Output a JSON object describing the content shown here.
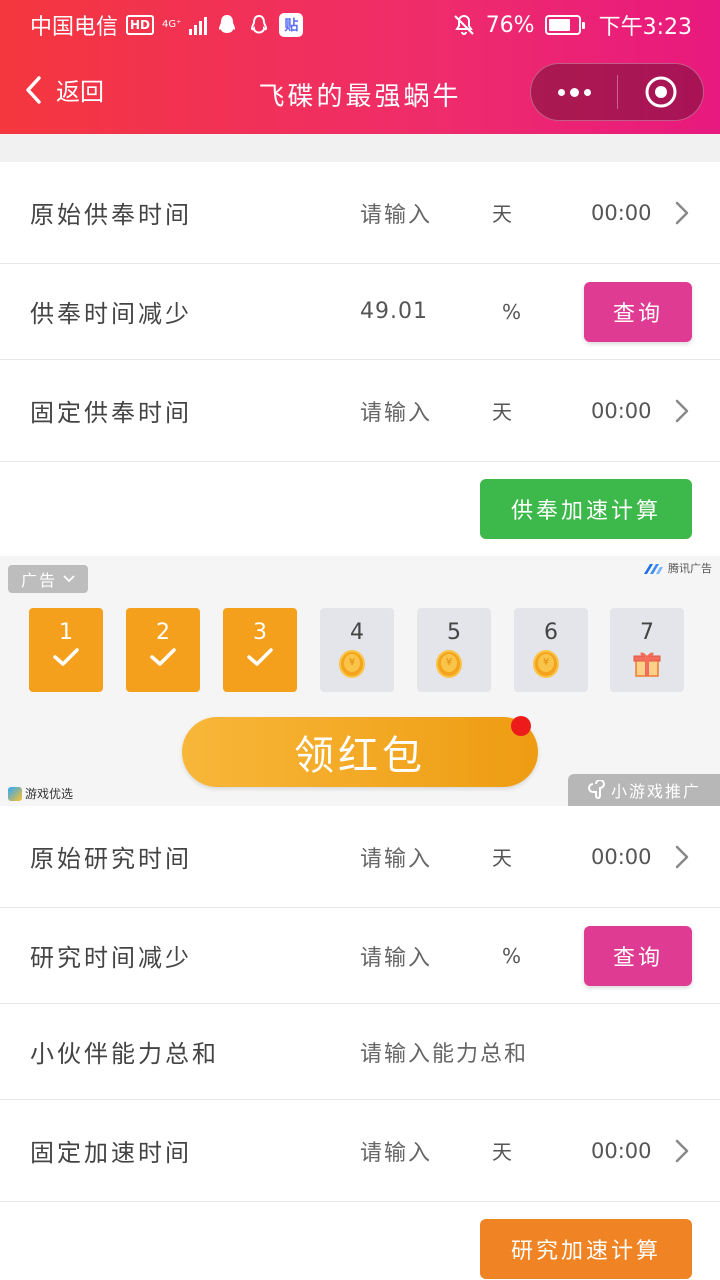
{
  "status_bar": {
    "carrier": "中国电信",
    "hd": "HD",
    "network": "4G⁺",
    "battery_percent": "76%",
    "time": "下午3:23",
    "tie_badge": "贴",
    "icons": [
      "hd-icon",
      "signal-icon",
      "qq-icon",
      "qq-outline-icon",
      "tieba-icon",
      "mute-icon",
      "battery-icon"
    ]
  },
  "nav": {
    "back_label": "返回",
    "title": "飞碟的最强蜗牛"
  },
  "supply": {
    "rows": [
      {
        "label": "原始供奉时间",
        "input": "请输入",
        "unit": "天",
        "time": "00:00"
      },
      {
        "label": "供奉时间减少",
        "input": "49.01",
        "unit": "%",
        "button": "查询"
      },
      {
        "label": "固定供奉时间",
        "input": "请输入",
        "unit": "天",
        "time": "00:00"
      }
    ],
    "calc_button": "供奉加速计算"
  },
  "ad": {
    "tag": "广告",
    "brand": "腾讯广告",
    "days": [
      {
        "n": "1",
        "done": true
      },
      {
        "n": "2",
        "done": true
      },
      {
        "n": "3",
        "done": true
      },
      {
        "n": "4",
        "done": false,
        "reward": "coin"
      },
      {
        "n": "5",
        "done": false,
        "reward": "coin"
      },
      {
        "n": "6",
        "done": false,
        "reward": "coin"
      },
      {
        "n": "7",
        "done": false,
        "reward": "gift"
      }
    ],
    "coin_symbol": "¥",
    "redpack": "领红包",
    "left_brand": "游戏优选",
    "promo": "小游戏推广"
  },
  "research": {
    "rows": [
      {
        "label": "原始研究时间",
        "input": "请输入",
        "unit": "天",
        "time": "00:00"
      },
      {
        "label": "研究时间减少",
        "input": "请输入",
        "unit": "%",
        "button": "查询"
      },
      {
        "label": "小伙伴能力总和",
        "input": "请输入能力总和"
      },
      {
        "label": "固定加速时间",
        "input": "请输入",
        "unit": "天",
        "time": "00:00"
      }
    ],
    "calc_button": "研究加速计算"
  },
  "colors": {
    "header_start": "#f4373e",
    "header_end": "#e8197f",
    "query_button": "#e03b93",
    "calc_green": "#3db84a",
    "calc_orange": "#f08424",
    "reward_done": "#f5a01c"
  }
}
